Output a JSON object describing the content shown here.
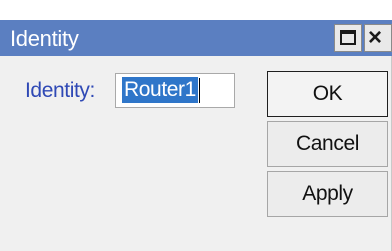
{
  "window": {
    "title": "Identity"
  },
  "titlebar_buttons": {
    "maximize_icon": "maximize-icon",
    "close_icon": "close-icon",
    "close_glyph": "×"
  },
  "form": {
    "identity_label": "Identity:",
    "identity_value": "Router1"
  },
  "buttons": {
    "ok": "OK",
    "cancel": "Cancel",
    "apply": "Apply"
  },
  "colors": {
    "titlebar": "#5b7fc1",
    "label": "#2f49b5",
    "selection": "#2f76c9"
  }
}
